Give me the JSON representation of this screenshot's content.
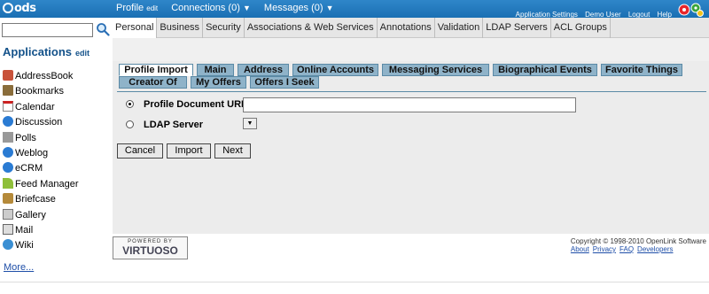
{
  "topbar": {
    "logo": "ods",
    "nav": [
      {
        "label": "Profile",
        "suffix": "edit"
      },
      {
        "label": "Connections (0)",
        "suffix": "▼"
      },
      {
        "label": "Messages (0)",
        "suffix": "▼"
      }
    ],
    "links": [
      "Application Settings",
      "Demo User",
      "Logout",
      "Help"
    ]
  },
  "search": {
    "value": "",
    "placeholder": ""
  },
  "tabs": [
    "Personal",
    "Business",
    "Security",
    "Associations & Web Services",
    "Annotations",
    "Validation",
    "LDAP Servers",
    "ACL Groups"
  ],
  "sidebar": {
    "title": "Applications",
    "edit_label": "edit",
    "items": [
      {
        "label": "AddressBook",
        "icon": "addressbook-icon",
        "color": "#c8523a"
      },
      {
        "label": "Bookmarks",
        "icon": "bookmarks-icon",
        "color": "#8a6d3b"
      },
      {
        "label": "Calendar",
        "icon": "calendar-icon",
        "color": "#c22"
      },
      {
        "label": "Discussion",
        "icon": "discussion-icon",
        "color": "#2a7bd3"
      },
      {
        "label": "Polls",
        "icon": "polls-icon",
        "color": "#777"
      },
      {
        "label": "Weblog",
        "icon": "weblog-icon",
        "color": "#2a7bd3"
      },
      {
        "label": "eCRM",
        "icon": "ecrm-icon",
        "color": "#2a7bd3"
      },
      {
        "label": "Feed Manager",
        "icon": "feed-manager-icon",
        "color": "#8fbf3a"
      },
      {
        "label": "Briefcase",
        "icon": "briefcase-icon",
        "color": "#b58a3a"
      },
      {
        "label": "Gallery",
        "icon": "gallery-icon",
        "color": "#888"
      },
      {
        "label": "Mail",
        "icon": "mail-icon",
        "color": "#666"
      },
      {
        "label": "Wiki",
        "icon": "wiki-icon",
        "color": "#3a8fd3"
      }
    ],
    "more": "More..."
  },
  "subtabs": [
    "Profile Import",
    "Main",
    "Address",
    "Online Accounts",
    "Messaging Services",
    "Biographical Events",
    "Favorite Things",
    "Creator Of",
    "My Offers",
    "Offers I Seek"
  ],
  "form": {
    "url_label": "Profile Document URL",
    "url_value": "",
    "ldap_label": "LDAP Server",
    "ldap_value": "",
    "buttons": [
      "Cancel",
      "Import",
      "Next"
    ]
  },
  "footer": {
    "badge_top": "POWERED BY",
    "badge_name": "VIRTUOSO",
    "copyright": "Copyright © 1998-2010 OpenLink Software",
    "links": [
      "About",
      "Privacy",
      "FAQ",
      "Developers"
    ]
  },
  "colors": {
    "topbar": "#1f77c0",
    "subtab": "#8fb3c9",
    "title": "#14528a"
  }
}
